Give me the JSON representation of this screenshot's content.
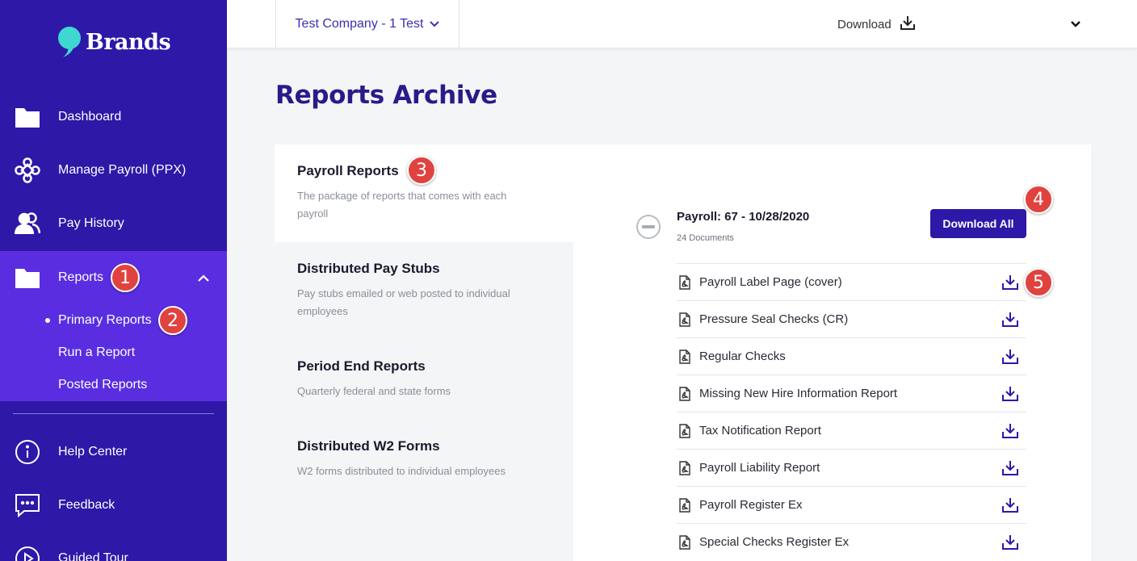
{
  "brand": {
    "name": "Brands"
  },
  "sidebar": {
    "items": [
      {
        "label": "Dashboard",
        "icon": "folder-icon"
      },
      {
        "label": "Manage Payroll (PPX)",
        "icon": "payroll-network-icon"
      },
      {
        "label": "Pay History",
        "icon": "people-icon"
      },
      {
        "label": "Reports",
        "icon": "folder-icon"
      }
    ],
    "sub_items": [
      "Primary Reports",
      "Run a Report",
      "Posted Reports"
    ],
    "bottom_items": [
      {
        "label": "Help Center",
        "icon": "info-icon"
      },
      {
        "label": "Feedback",
        "icon": "chat-icon"
      },
      {
        "label": "Guided Tour",
        "icon": "play-icon"
      }
    ]
  },
  "header": {
    "company": "Test Company - 1 Test",
    "download_label": "Download"
  },
  "page": {
    "title": "Reports Archive"
  },
  "categories": [
    {
      "title": "Payroll Reports",
      "desc": "The package of reports that comes with each payroll"
    },
    {
      "title": "Distributed Pay Stubs",
      "desc": "Pay stubs emailed or web posted to individual employees"
    },
    {
      "title": "Period End Reports",
      "desc": "Quarterly federal and state forms"
    },
    {
      "title": "Distributed W2 Forms",
      "desc": "W2 forms distributed to individual employees"
    }
  ],
  "payroll": {
    "title": "Payroll: 67 - 10/28/2020",
    "count": "24 Documents",
    "download_all": "Download All"
  },
  "documents": [
    "Payroll Label Page (cover)",
    "Pressure Seal Checks (CR)",
    "Regular Checks",
    "Missing New Hire Information Report",
    "Tax Notification Report",
    "Payroll Liability Report",
    "Payroll Register Ex",
    "Special Checks Register Ex"
  ],
  "badges": [
    "1",
    "2",
    "3",
    "4",
    "5"
  ],
  "colors": {
    "sidebar": "#2d18a8",
    "sidebar_active": "#5a2ee0",
    "accent": "#2d18a8",
    "badge": "#e0433f",
    "logo_accent": "#3fd8d0"
  }
}
